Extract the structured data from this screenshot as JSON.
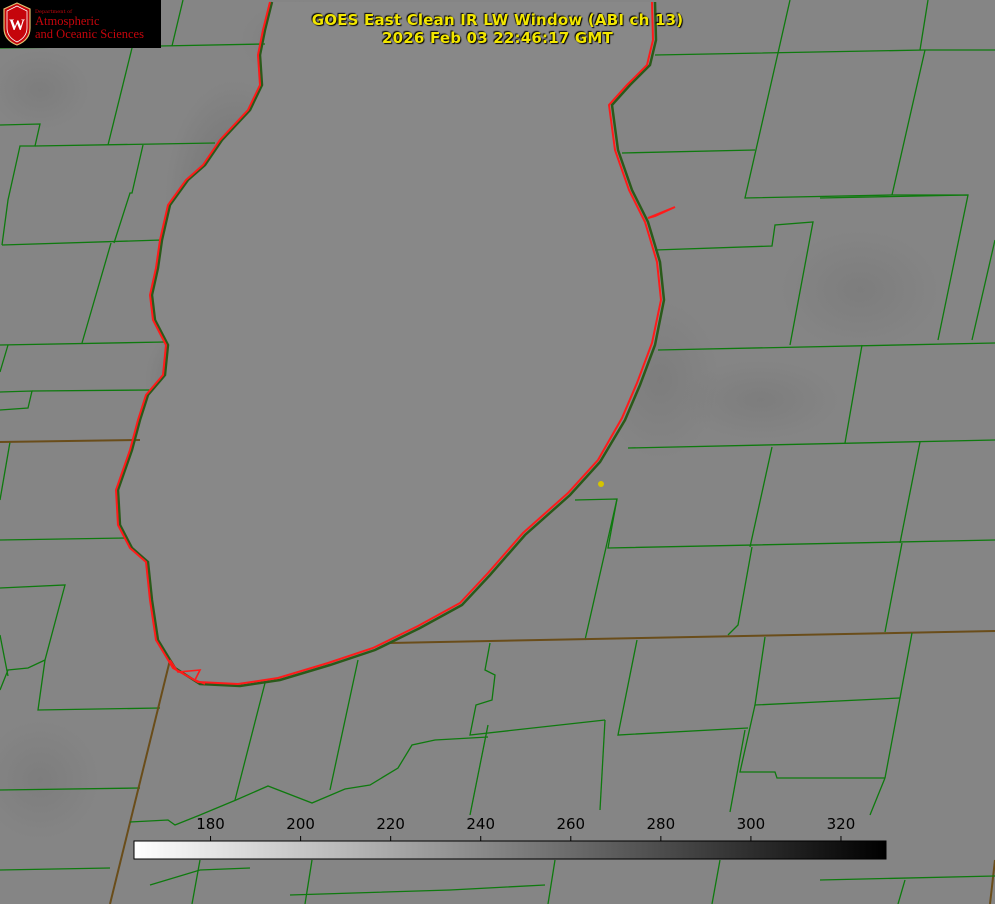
{
  "title": {
    "line1": "GOES East Clean IR LW Window (ABI ch 13)",
    "line2": "2026 Feb 03 22:46:17 GMT"
  },
  "logo": {
    "small_text": "Department of",
    "line1": "Atmospheric",
    "line2": "and Oceanic Sciences",
    "seal_letter": "W"
  },
  "colorbar": {
    "ticks": [
      "180",
      "200",
      "220",
      "240",
      "260",
      "280",
      "300",
      "320"
    ],
    "range": [
      163,
      330
    ],
    "ramp": "white-to-black"
  },
  "colors": {
    "background_gray": "#858585",
    "lake_gray": "#888888",
    "county_lines": "#0e7a0e",
    "shoreline": "#ff1a1a",
    "title_text": "#f2e600",
    "logo_red": "#c5050c"
  },
  "markers": [
    {
      "name": "station-dot",
      "color": "#d4c400"
    }
  ]
}
